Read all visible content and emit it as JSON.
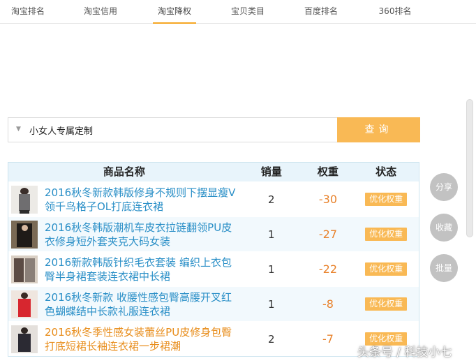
{
  "tabs": [
    {
      "label": "淘宝排名",
      "active": false
    },
    {
      "label": "淘宝信用",
      "active": false
    },
    {
      "label": "淘宝降权",
      "active": true
    },
    {
      "label": "宝贝类目",
      "active": false
    },
    {
      "label": "百度排名",
      "active": false
    },
    {
      "label": "360排名",
      "active": false
    }
  ],
  "search": {
    "value": "小女人专属定制",
    "button_label": "查询"
  },
  "table": {
    "headers": {
      "name": "商品名称",
      "sales": "销量",
      "weight": "权重",
      "status": "状态"
    },
    "rows": [
      {
        "name": "2016秋冬新款韩版修身不规则下摆显瘦V领千鸟格子OL打底连衣裙",
        "sales": "2",
        "weight": "-30",
        "action": "优化权重"
      },
      {
        "name": "2016秋冬韩版潮机车皮衣拉链翻领PU皮衣修身短外套夹克大码女装",
        "sales": "1",
        "weight": "-27",
        "action": "优化权重"
      },
      {
        "name": "2016新款韩版针织毛衣套装 编织上衣包臀半身裙套装连衣裙中长裙",
        "sales": "1",
        "weight": "-22",
        "action": "优化权重"
      },
      {
        "name": "2016秋冬新款 收腰性感包臀高腰开叉红色蝴蝶结中长款礼服连衣裙",
        "sales": "1",
        "weight": "-8",
        "action": "优化权重"
      },
      {
        "name": "2016秋冬季性感女装蕾丝PU皮修身包臀打底短裙长袖连衣裙一步裙潮",
        "sales": "2",
        "weight": "-7",
        "action": "优化权重"
      }
    ]
  },
  "side_buttons": {
    "share": "分享",
    "collect": "收藏",
    "batch": "批量"
  },
  "watermark": "头条号 / 科技小七",
  "colors": {
    "accent": "#f9b955",
    "link": "#2a8fc7",
    "weight": "#e8812a",
    "header_bg": "#e8f4fb"
  }
}
